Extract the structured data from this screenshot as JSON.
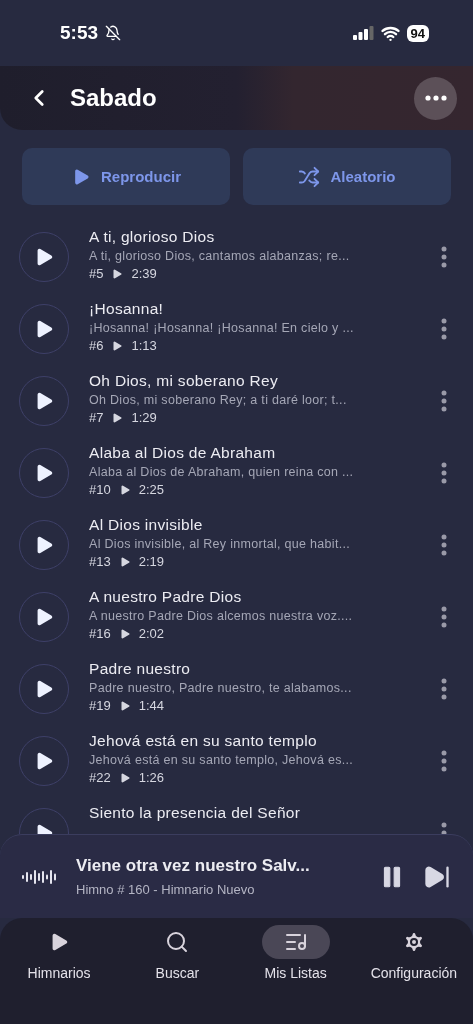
{
  "status_bar": {
    "time": "5:53",
    "battery": "94"
  },
  "header": {
    "title": "Sabado"
  },
  "actions": [
    {
      "kind": "play",
      "label": "Reproducir"
    },
    {
      "kind": "shuffle",
      "label": "Aleatorio"
    }
  ],
  "songs": [
    {
      "title": "A ti, glorioso Dios",
      "excerpt": "A ti, glorioso Dios, cantamos alabanzas; re...",
      "number": "#5",
      "duration": "2:39"
    },
    {
      "title": "¡Hosanna!",
      "excerpt": "¡Hosanna! ¡Hosanna! ¡Hosanna! En cielo y ...",
      "number": "#6",
      "duration": "1:13"
    },
    {
      "title": "Oh Dios, mi soberano Rey",
      "excerpt": "Oh Dios, mi soberano Rey; a ti daré loor; t...",
      "number": "#7",
      "duration": "1:29"
    },
    {
      "title": "Alaba al Dios de Abraham",
      "excerpt": "Alaba al Dios de Abraham, quien reina con ...",
      "number": "#10",
      "duration": "2:25"
    },
    {
      "title": "Al Dios invisible",
      "excerpt": "Al Dios invisible, al Rey inmortal, que habit...",
      "number": "#13",
      "duration": "2:19"
    },
    {
      "title": "A nuestro Padre Dios",
      "excerpt": "A nuestro Padre Dios alcemos nuestra voz....",
      "number": "#16",
      "duration": "2:02"
    },
    {
      "title": "Padre nuestro",
      "excerpt": "Padre nuestro, Padre nuestro, te alabamos...",
      "number": "#19",
      "duration": "1:44"
    },
    {
      "title": "Jehová está en su santo templo",
      "excerpt": "Jehová está en su santo templo, Jehová es...",
      "number": "#22",
      "duration": "1:26"
    },
    {
      "title": "Siento la presencia del Señor"
    }
  ],
  "now_playing": {
    "title": "Viene otra vez nuestro Salv...",
    "subtitle": "Himno # 160 - Himnario Nuevo",
    "playing": true
  },
  "tabs": [
    {
      "kind": "hymnals",
      "label": "Himnarios",
      "selected": false
    },
    {
      "kind": "search",
      "label": "Buscar",
      "selected": false
    },
    {
      "kind": "lists",
      "label": "Mis Listas",
      "selected": true
    },
    {
      "kind": "settings",
      "label": "Configuración",
      "selected": false
    }
  ]
}
